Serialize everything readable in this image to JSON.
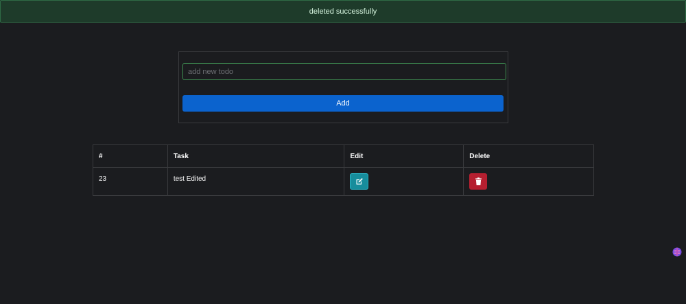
{
  "toast": {
    "message": "deleted successfully"
  },
  "form": {
    "input_placeholder": "add new todo",
    "input_value": "",
    "add_label": "Add"
  },
  "table": {
    "headers": [
      "#",
      "Task",
      "Edit",
      "Delete"
    ],
    "rows": [
      {
        "id": "23",
        "task": "test Edited"
      }
    ]
  },
  "icons": {
    "edit": "edit-square-pen-icon",
    "delete": "trash-icon",
    "extension": "brain-extension-icon"
  },
  "colors": {
    "background": "#1b1c1f",
    "toast_bg": "#1e3b2a",
    "primary": "#0b63ce",
    "edit": "#178d9c",
    "delete": "#b51f30"
  }
}
